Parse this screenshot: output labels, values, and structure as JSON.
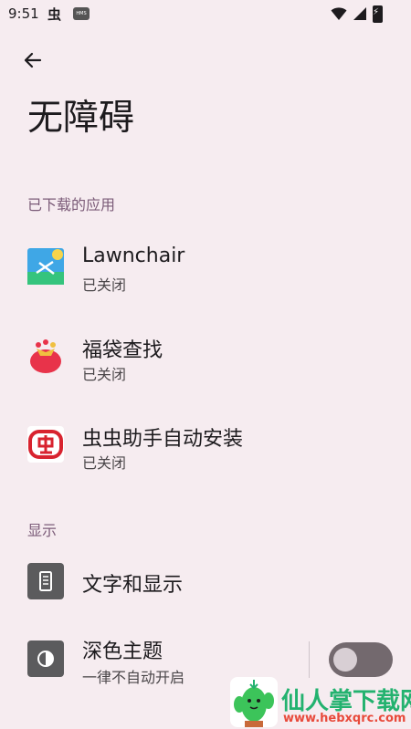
{
  "status_bar": {
    "time": "9:51",
    "app_glyph": "虫",
    "hms_badge": "HMS",
    "icons": [
      "wifi-icon",
      "signal-icon",
      "battery-charging-icon"
    ]
  },
  "header": {
    "back_icon": "arrow-left-icon",
    "title": "无障碍"
  },
  "sections": {
    "downloaded": {
      "header": "已下载的应用",
      "items": [
        {
          "title": "Lawnchair",
          "subtitle": "已关闭",
          "icon": "lawnchair-icon"
        },
        {
          "title": "福袋查找",
          "subtitle": "已关闭",
          "icon": "lucky-bag-icon"
        },
        {
          "title": "虫虫助手自动安装",
          "subtitle": "已关闭",
          "icon": "chongchong-icon"
        }
      ]
    },
    "display": {
      "header": "显示",
      "items": [
        {
          "title": "文字和显示",
          "icon": "text-display-icon"
        },
        {
          "title": "深色主题",
          "subtitle": "一律不自动开启",
          "icon": "dark-theme-icon",
          "toggle": "off"
        }
      ]
    }
  },
  "watermark": {
    "text": "仙人掌下载网",
    "url": "www.hebxqrc.com"
  },
  "colors": {
    "background": "#f6ecf0",
    "section_header": "#7b5b78",
    "toggle_track": "#73696e",
    "watermark_green": "#23b26f",
    "watermark_red": "#e84a3b"
  }
}
